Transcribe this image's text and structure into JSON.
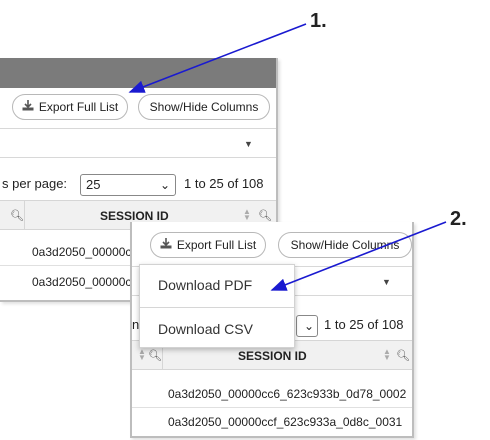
{
  "step_labels": {
    "first": "1.",
    "second": "2."
  },
  "toolbar": {
    "export_label": "Export Full List",
    "columns_label": "Show/Hide Columns"
  },
  "pagination": {
    "per_page_label": "s per page:",
    "per_page_value": "25",
    "range_text": "1 to 25 of 108",
    "per_page_fragment": "n"
  },
  "table": {
    "column_header": "SESSION ID"
  },
  "panel1_rows": [
    "0a3d2050_00000cc",
    "0a3d2050_00000c"
  ],
  "panel2_rows": [
    "0a3d2050_00000cc6_623c933b_0d78_0002",
    "0a3d2050_00000ccf_623c933a_0d8c_0031"
  ],
  "menu": {
    "pdf": "Download PDF",
    "csv": "Download CSV"
  },
  "colors": {
    "arrow": "#1a1ad0",
    "header_bar": "#7b7b7b",
    "table_header_bg": "#f1f1f1"
  }
}
